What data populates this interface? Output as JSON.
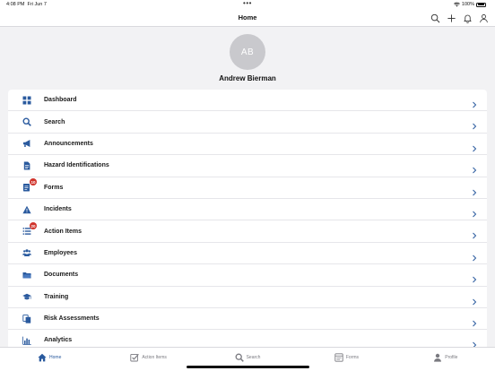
{
  "status_bar": {
    "time": "4:08 PM",
    "date": "Fri Jun 7",
    "dots": "•••",
    "battery_text": "100%"
  },
  "nav": {
    "title": "Home",
    "icons": [
      "search-icon",
      "plus-icon",
      "bell-icon",
      "person-icon"
    ]
  },
  "profile": {
    "initials": "AB",
    "name": "Andrew Bierman"
  },
  "menu": {
    "items": [
      {
        "label": "Dashboard",
        "icon": "grid-icon",
        "badge": ""
      },
      {
        "label": "Search",
        "icon": "search-icon",
        "badge": ""
      },
      {
        "label": "Announcements",
        "icon": "megaphone-icon",
        "badge": ""
      },
      {
        "label": "Hazard Identifications",
        "icon": "document-icon",
        "badge": ""
      },
      {
        "label": "Forms",
        "icon": "form-icon",
        "badge": "10"
      },
      {
        "label": "Incidents",
        "icon": "warning-icon",
        "badge": ""
      },
      {
        "label": "Action Items",
        "icon": "list-icon",
        "badge": "20"
      },
      {
        "label": "Employees",
        "icon": "people-icon",
        "badge": ""
      },
      {
        "label": "Documents",
        "icon": "folder-icon",
        "badge": ""
      },
      {
        "label": "Training",
        "icon": "graduation-cap-icon",
        "badge": ""
      },
      {
        "label": "Risk Assessments",
        "icon": "copy-documents-icon",
        "badge": ""
      },
      {
        "label": "Analytics",
        "icon": "bar-chart-icon",
        "badge": ""
      }
    ]
  },
  "tabs": [
    {
      "label": "Home",
      "icon": "home-icon",
      "active": true
    },
    {
      "label": "Action Items",
      "icon": "checkbox-icon",
      "active": false
    },
    {
      "label": "Search",
      "icon": "search-icon",
      "active": false
    },
    {
      "label": "Forms",
      "icon": "forms-icon",
      "active": false
    },
    {
      "label": "Profile",
      "icon": "person-icon",
      "active": false
    }
  ],
  "colors": {
    "accent": "#2a5a9e",
    "badge": "#d0342c",
    "background": "#f2f2f4"
  }
}
